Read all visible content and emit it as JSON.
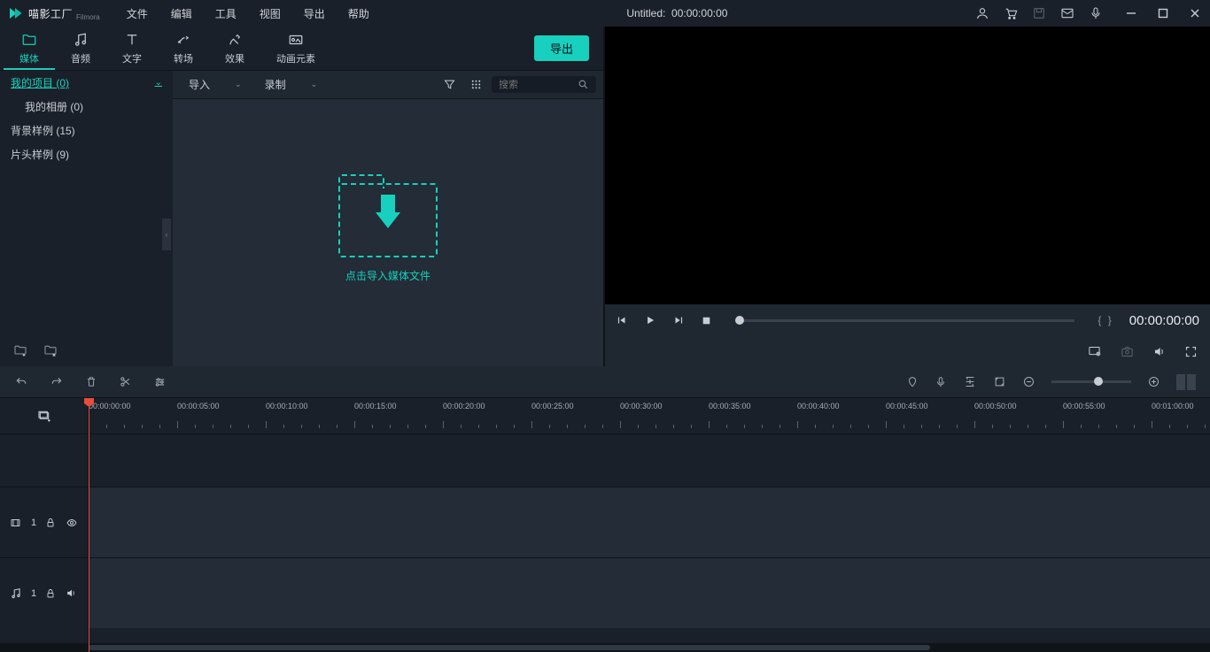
{
  "app": {
    "name": "喵影工厂",
    "sub": "Filmora"
  },
  "menu": [
    "文件",
    "编辑",
    "工具",
    "视图",
    "导出",
    "帮助"
  ],
  "title": {
    "project": "Untitled:",
    "time": "00:00:00:00"
  },
  "tabs": {
    "items": [
      {
        "label": "媒体"
      },
      {
        "label": "音频"
      },
      {
        "label": "文字"
      },
      {
        "label": "转场"
      },
      {
        "label": "效果"
      },
      {
        "label": "动画元素"
      }
    ],
    "export": "导出"
  },
  "tree": {
    "my_project": "我的项目 (0)",
    "my_album": "我的相册 (0)",
    "bg_samples": "背景样例 (15)",
    "intro_samples": "片头样例 (9)"
  },
  "media_toolbar": {
    "import": "导入",
    "record": "录制",
    "search_placeholder": "搜索"
  },
  "dropzone": {
    "label": "点击导入媒体文件"
  },
  "preview": {
    "time": "00:00:00:00",
    "markers": "{   }"
  },
  "timeline": {
    "ticks": [
      "00:00:00:00",
      "00:00:05:00",
      "00:00:10:00",
      "00:00:15:00",
      "00:00:20:00",
      "00:00:25:00",
      "00:00:30:00",
      "00:00:35:00",
      "00:00:40:00",
      "00:00:45:00",
      "00:00:50:00",
      "00:00:55:00",
      "00:01:00:00"
    ],
    "video_track": "1",
    "audio_track": "1"
  }
}
